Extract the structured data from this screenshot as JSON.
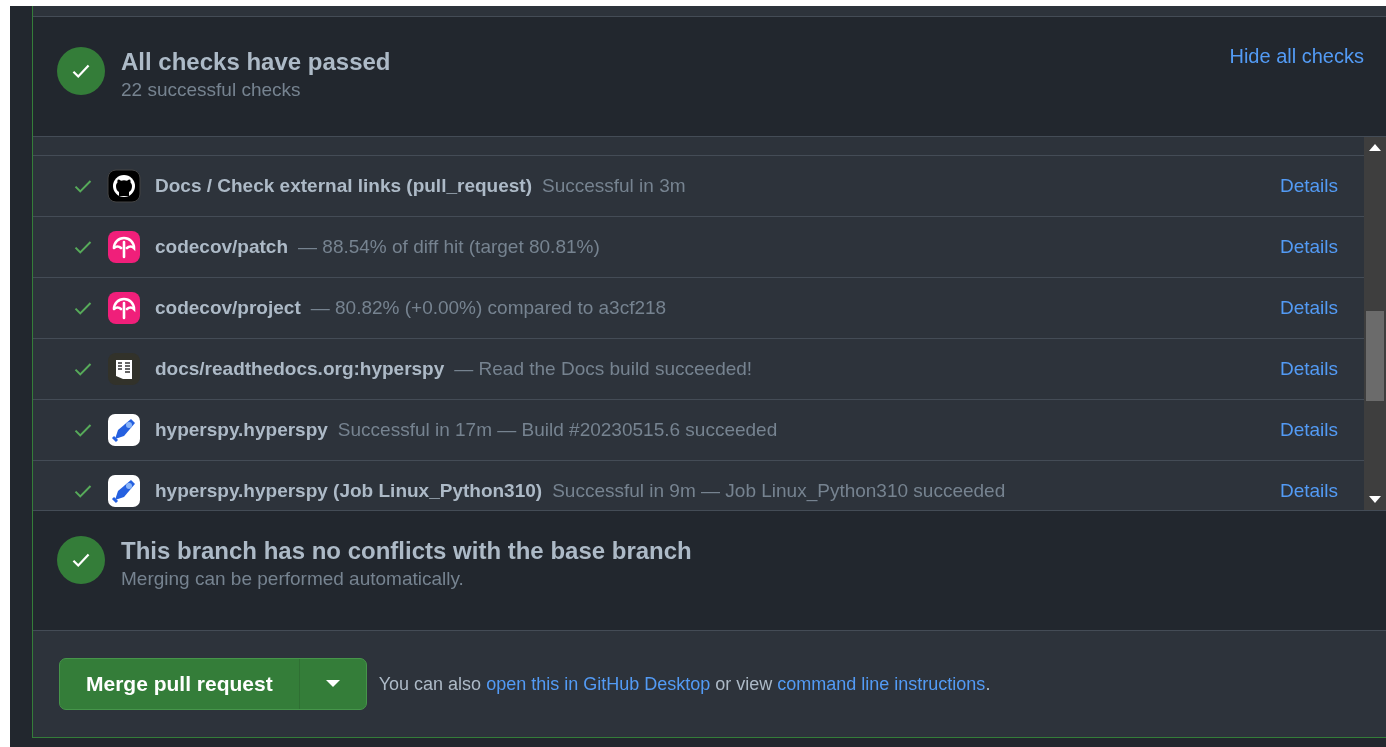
{
  "checks_summary": {
    "title": "All checks have passed",
    "subtitle": "22 successful checks",
    "toggle_link": "Hide all checks"
  },
  "checks": [
    {
      "kind": "github",
      "name": "Docs / Check external links (pull_request)",
      "description": "Successful in 3m",
      "details": "Details"
    },
    {
      "kind": "codecov",
      "name": "codecov/patch",
      "description": "— 88.54% of diff hit (target 80.81%)",
      "details": "Details"
    },
    {
      "kind": "codecov",
      "name": "codecov/project",
      "description": "— 80.82% (+0.00%) compared to a3cf218",
      "details": "Details"
    },
    {
      "kind": "readthedocs",
      "name": "docs/readthedocs.org:hyperspy",
      "description": "— Read the Docs build succeeded!",
      "details": "Details"
    },
    {
      "kind": "pipelines",
      "name": "hyperspy.hyperspy",
      "description": "Successful in 17m — Build #20230515.6 succeeded",
      "details": "Details"
    },
    {
      "kind": "pipelines",
      "name": "hyperspy.hyperspy (Job Linux_Python310)",
      "description": "Successful in 9m — Job Linux_Python310 succeeded",
      "details": "Details"
    }
  ],
  "merge_status": {
    "title": "This branch has no conflicts with the base branch",
    "subtitle": "Merging can be performed automatically."
  },
  "merge_box": {
    "button": "Merge pull request",
    "note_prefix": "You can also",
    "link_1": "open this in GitHub Desktop",
    "note_middle": "or view",
    "link_2": "command line instructions",
    "note_suffix": "."
  }
}
